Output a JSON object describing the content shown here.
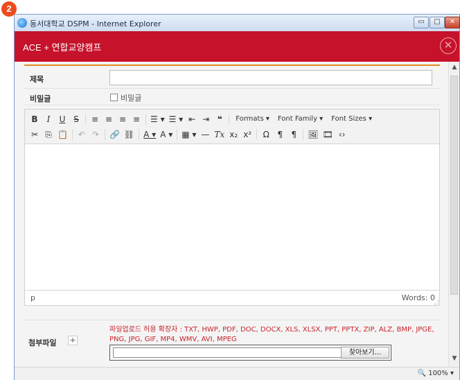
{
  "badge": "2",
  "window": {
    "title": "동서대학교 DSPM - Internet Explorer",
    "min_symbol": "▭",
    "max_symbol": "□",
    "close_symbol": "✕"
  },
  "app": {
    "title": "ACE + 연합교양캠프",
    "close_symbol": "✕"
  },
  "form": {
    "subject_label": "제목",
    "subject_value": "",
    "secret_label": "비밀글",
    "secret_checkbox_label": "비밀글"
  },
  "editor": {
    "toolbar_row1": [
      {
        "name": "bold-button",
        "text": "B",
        "cls": "bold"
      },
      {
        "name": "italic-button",
        "text": "I",
        "cls": "ital"
      },
      {
        "name": "underline-button",
        "text": "U",
        "cls": "under"
      },
      {
        "name": "strikethrough-button",
        "text": "S",
        "cls": "strike"
      },
      {
        "name": "align-left-icon",
        "text": "≡",
        "cls": ""
      },
      {
        "name": "align-center-icon",
        "text": "≡",
        "cls": ""
      },
      {
        "name": "align-right-icon",
        "text": "≡",
        "cls": ""
      },
      {
        "name": "align-justify-icon",
        "text": "≡",
        "cls": ""
      },
      {
        "name": "bullet-list-icon",
        "text": "☰ ▾",
        "cls": ""
      },
      {
        "name": "numbered-list-icon",
        "text": "☰ ▾",
        "cls": ""
      },
      {
        "name": "outdent-icon",
        "text": "⇤",
        "cls": ""
      },
      {
        "name": "indent-icon",
        "text": "⇥",
        "cls": ""
      },
      {
        "name": "blockquote-icon",
        "text": "❝",
        "cls": "bold"
      },
      {
        "name": "formats-menu",
        "text": "Formats ▾",
        "cls": "menu"
      },
      {
        "name": "font-family-menu",
        "text": "Font Family ▾",
        "cls": "menu"
      },
      {
        "name": "font-sizes-menu",
        "text": "Font Sizes ▾",
        "cls": "menu"
      }
    ],
    "toolbar_row2": [
      {
        "name": "cut-icon",
        "text": "✂",
        "cls": ""
      },
      {
        "name": "copy-icon",
        "text": "⎘",
        "cls": ""
      },
      {
        "name": "paste-icon",
        "text": "📋",
        "cls": ""
      },
      {
        "name": "undo-icon",
        "text": "↶",
        "cls": "grey"
      },
      {
        "name": "redo-icon",
        "text": "↷",
        "cls": "grey"
      },
      {
        "name": "link-icon",
        "text": "🔗",
        "cls": ""
      },
      {
        "name": "unlink-icon",
        "text": "⛓",
        "cls": ""
      },
      {
        "name": "text-color-icon",
        "text": "A ▾",
        "cls": "under"
      },
      {
        "name": "background-color-icon",
        "text": "A ▾",
        "cls": ""
      },
      {
        "name": "table-icon",
        "text": "▦ ▾",
        "cls": ""
      },
      {
        "name": "horizontal-rule-icon",
        "text": "—",
        "cls": ""
      },
      {
        "name": "clear-formatting-icon",
        "text": "Tx",
        "cls": "ital"
      },
      {
        "name": "subscript-icon",
        "text": "x₂",
        "cls": ""
      },
      {
        "name": "superscript-icon",
        "text": "x²",
        "cls": ""
      },
      {
        "name": "special-character-icon",
        "text": "Ω",
        "cls": ""
      },
      {
        "name": "ltr-icon",
        "text": "¶",
        "cls": ""
      },
      {
        "name": "rtl-icon",
        "text": "¶",
        "cls": ""
      },
      {
        "name": "image-icon",
        "text": "🖼",
        "cls": ""
      },
      {
        "name": "media-icon",
        "text": "🎞",
        "cls": ""
      },
      {
        "name": "source-code-icon",
        "text": "‹›",
        "cls": ""
      }
    ],
    "status_path": "p",
    "word_count": "Words: 0"
  },
  "attachment": {
    "label": "첨부파일",
    "plus": "+",
    "note": "파일업로드 허용 확장자 : TXT, HWP, PDF, DOC, DOCX, XLS, XLSX, PPT, PPTX, ZIP, ALZ, BMP, JPGE, PNG, JPG, GIF, MP4, WMV, AVI, MPEG",
    "browse_label": "찾아보기..."
  },
  "ie_status": {
    "zoom": "🔍 100%  ▾"
  }
}
